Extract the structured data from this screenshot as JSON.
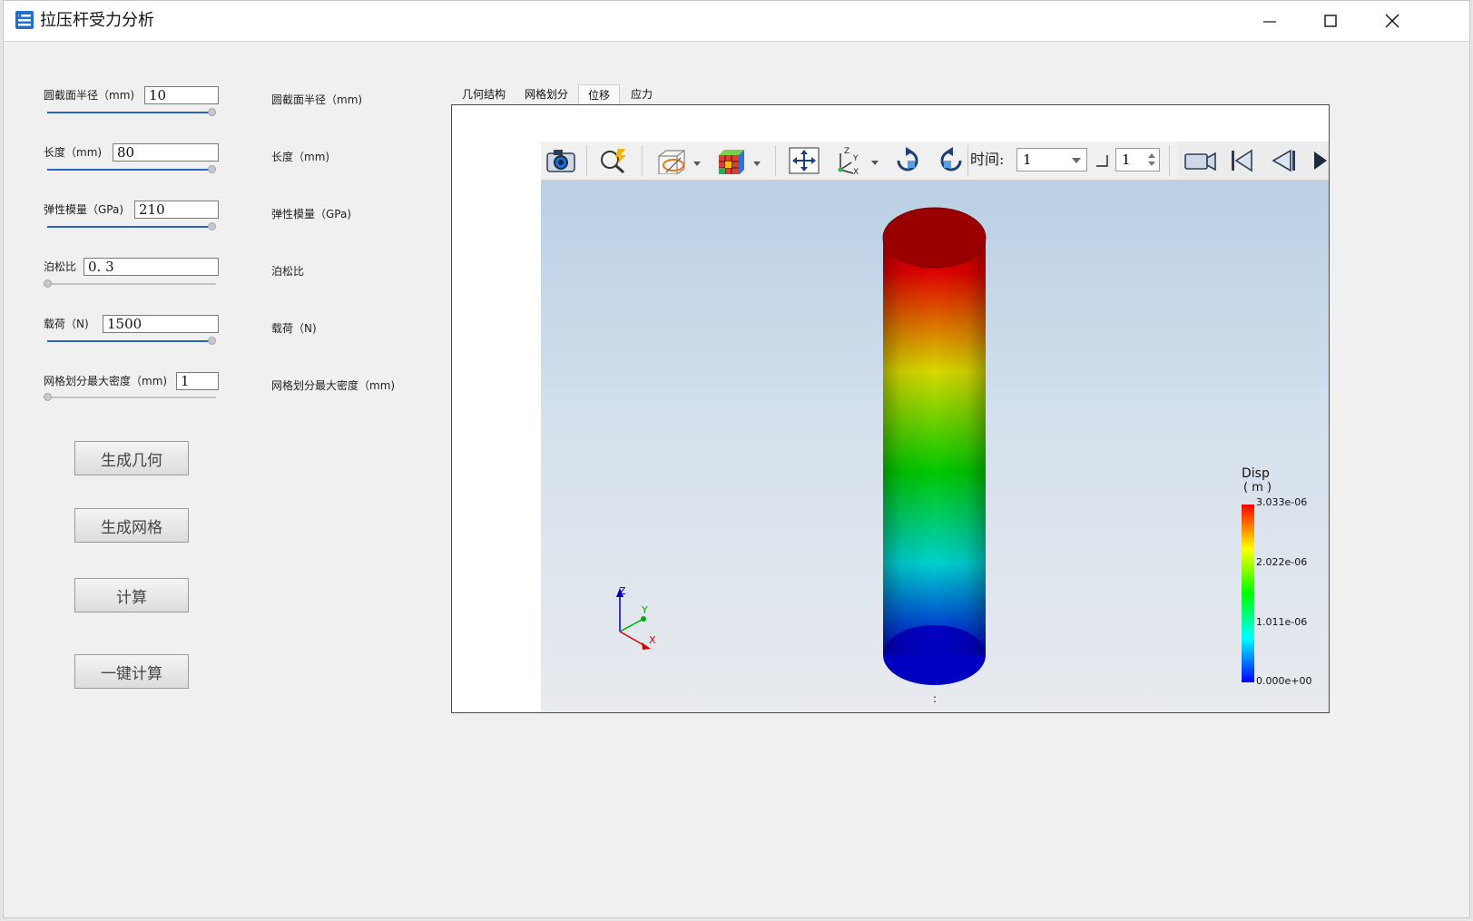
{
  "window": {
    "title": "拉压杆受力分析"
  },
  "params": [
    {
      "label": "圆截面半径（mm)",
      "value": "10",
      "slider": 1.0
    },
    {
      "label": "长度（mm)",
      "value": "80",
      "slider": 1.0
    },
    {
      "label": "弹性模量（GPa)",
      "value": "210",
      "slider": 1.0
    },
    {
      "label": "泊松比",
      "value": "0. 3",
      "slider": 0.0
    },
    {
      "label": "载荷（N)",
      "value": "1500",
      "slider": 1.0
    },
    {
      "label": "网格划分最大密度（mm)",
      "value": "1",
      "slider": 0.0
    }
  ],
  "mirror_labels": [
    "圆截面半径（mm)",
    "长度（mm)",
    "弹性模量（GPa)",
    "泊松比",
    "载荷（N)",
    "网格划分最大密度（mm)"
  ],
  "buttons": {
    "gen_geometry": "生成几何",
    "gen_mesh": "生成网格",
    "compute": "计算",
    "one_click": "一键计算"
  },
  "tabs": [
    "几何结构",
    "网格划分",
    "位移",
    "应力"
  ],
  "active_tab": "位移",
  "toolbar": {
    "time_label": "时间:",
    "time_value": "1",
    "step_value": "1"
  },
  "legend": {
    "title": "Disp",
    "unit": "( m )",
    "ticks": [
      "3.033e-06",
      "2.022e-06",
      "1.011e-06",
      "0.000e+00"
    ]
  },
  "triad": {
    "x": "X",
    "y": "Y",
    "z": "Z"
  },
  "scene_caption": ":",
  "colors": {
    "accent": "#2a63c2",
    "colormap": [
      "#ff0000",
      "#ffff00",
      "#00ff00",
      "#00ffff",
      "#0000ff"
    ]
  }
}
